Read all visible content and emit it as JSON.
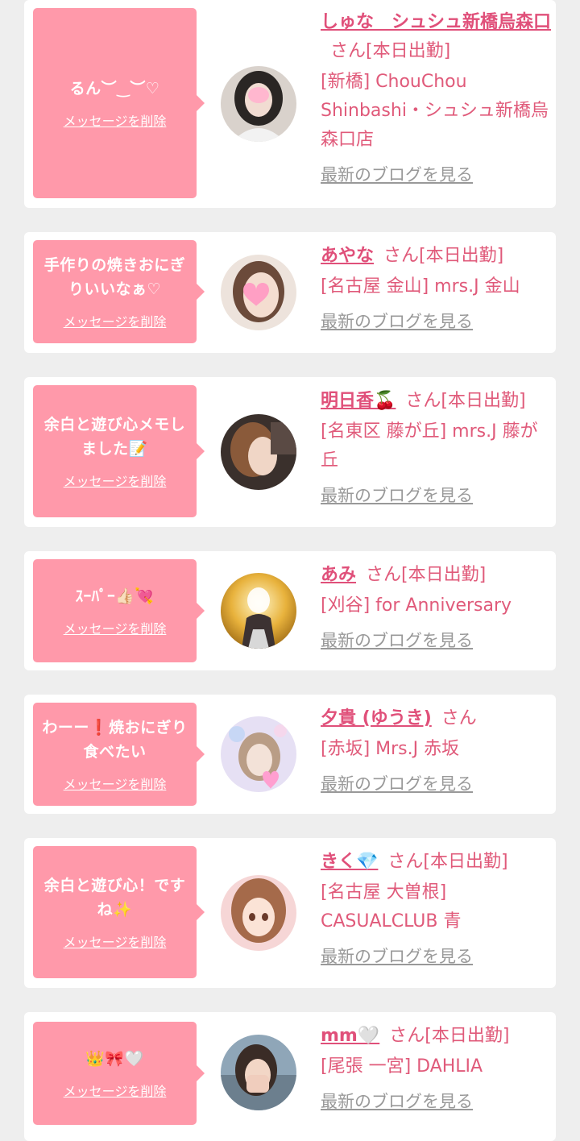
{
  "delete_label": "メッセージを削除",
  "blog_label": "最新のブログを見る",
  "colors": {
    "bubble": "#ff99aa",
    "name": "#e0507a",
    "text": "#e05a7a",
    "blog_link": "#999999",
    "background": "#eeeeee"
  },
  "entries": [
    {
      "message": "るん︶‿︶♡",
      "name": "しゅな　シュシュ新橋烏森口",
      "suffix": "さん[本日出勤]",
      "shop": "[新橋] ChouChou Shinbashi・シュシュ新橋烏森口店",
      "avatar_icon": "avatar-photo-icon"
    },
    {
      "message": "手作りの焼きおにぎりいいなぁ♡",
      "name": "あやな",
      "suffix": "さん[本日出勤]",
      "shop": "[名古屋 金山] mrs.J 金山",
      "avatar_icon": "avatar-photo-icon"
    },
    {
      "message": "余白と遊び心メモしました📝",
      "name": "明日香🍒",
      "suffix": "さん[本日出勤]",
      "shop": "[名東区 藤が丘] mrs.J 藤が丘",
      "avatar_icon": "avatar-photo-icon"
    },
    {
      "message": "ｽｰﾊﾟｰ👍🏻💘",
      "name": "あみ",
      "suffix": "さん[本日出勤]",
      "shop": "[刈谷] for Anniversary",
      "avatar_icon": "avatar-photo-icon"
    },
    {
      "message": "わーー❗焼おにぎり食べたい",
      "name": "夕貴 (ゆうき)",
      "suffix": "さん",
      "shop": "[赤坂] Mrs.J 赤坂",
      "avatar_icon": "avatar-photo-icon"
    },
    {
      "message": "余白と遊び心！ですね✨",
      "name": "きく💎",
      "suffix": "さん[本日出勤]",
      "shop": "[名古屋 大曽根] CASUALCLUB 青",
      "avatar_icon": "avatar-photo-icon"
    },
    {
      "message": "👑🎀🤍",
      "name": "mm🤍",
      "suffix": "さん[本日出勤]",
      "shop": "[尾張 一宮] DAHLIA",
      "avatar_icon": "avatar-photo-icon"
    }
  ]
}
